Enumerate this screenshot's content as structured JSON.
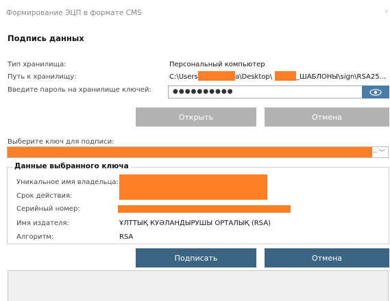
{
  "window": {
    "title": "Формирование ЭЦП в формате CMS",
    "close_glyph": "›"
  },
  "section": {
    "title": "Подпись данных"
  },
  "storage": {
    "type_label": "Тип хранилища:",
    "type_value": "Персональный компьютер",
    "path_label": "Путь к хранилищу:",
    "path_part1": "C:\\Users\\",
    "path_part2": "a\\Desktop\\",
    "path_part3": "_ШАБЛОНЫ\\sign\\RSA25...",
    "password_label": "Введите пароль на хранилище ключей:",
    "password_value": "●●●●●●●●●●",
    "eye_icon": "eye-icon"
  },
  "buttons": {
    "open": "Открыть",
    "cancel_top": "Отмена",
    "sign": "Подписать",
    "cancel_bottom": "Отмена"
  },
  "key_select": {
    "label": "Выберите ключ для подписи:",
    "ellipsis": "..",
    "chevron": "﹀"
  },
  "key_details": {
    "legend": "Данные выбранного ключа",
    "owner_label": "Уникальное имя владельца:",
    "validity_label": "Срок действия:",
    "serial_label": "Серийный номер:",
    "issuer_label": "Имя издателя:",
    "issuer_value": "ҰЛТТЫҚ КУӘЛАНДЫРУШЫ ОРТАЛЫҚ (RSA)",
    "algorithm_label": "Алгоритм:",
    "algorithm_value": "RSA"
  },
  "colors": {
    "primary_button": "#3c6584",
    "disabled_button": "#b3b3b3",
    "redaction": "#ff7f27",
    "eye_button": "#4a7ea8"
  }
}
